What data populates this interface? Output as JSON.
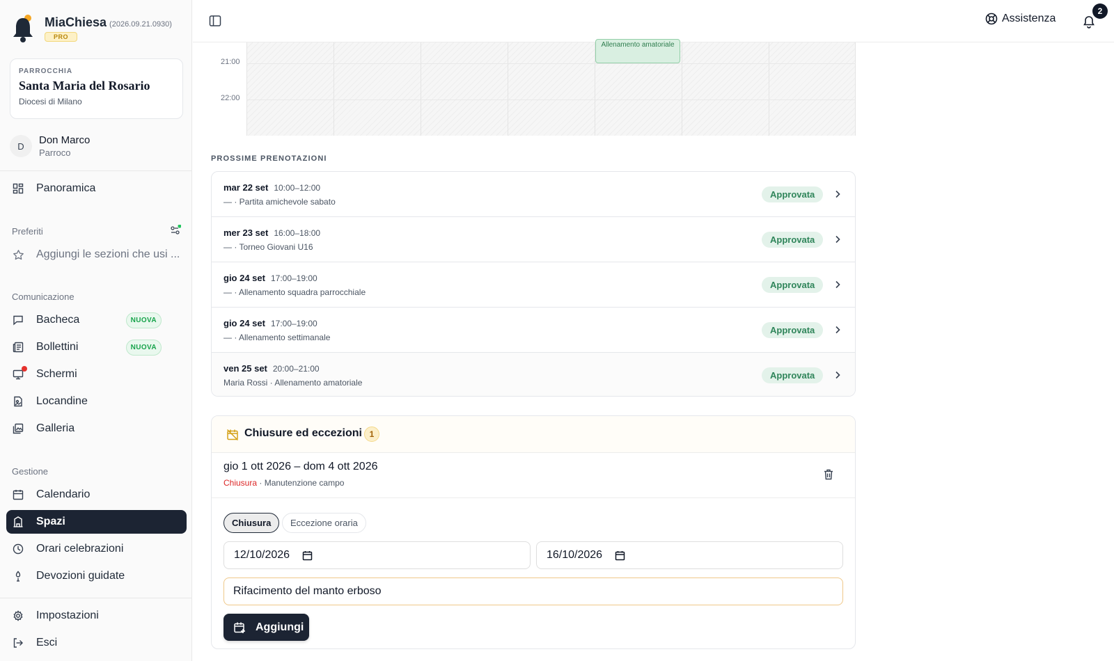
{
  "app": {
    "name": "MiaChiesa",
    "version": "(2026.09.21.0930)",
    "plan": "PRO"
  },
  "parish": {
    "kicker": "PARROCCHIA",
    "name": "Santa Maria del Rosario",
    "diocese": "Diocesi di Milano"
  },
  "user": {
    "initial": "D",
    "name": "Don Marco",
    "role": "Parroco"
  },
  "nav": {
    "overview": "Panoramica",
    "favorites_label": "Preferiti",
    "favorites_hint": "Aggiungi le sezioni che usi ...",
    "communication_label": "Comunicazione",
    "communication": [
      {
        "label": "Bacheca",
        "badge": "NUOVA"
      },
      {
        "label": "Bollettini",
        "badge": "NUOVA"
      },
      {
        "label": "Schermi"
      },
      {
        "label": "Locandine"
      },
      {
        "label": "Galleria"
      }
    ],
    "management_label": "Gestione",
    "management": [
      {
        "label": "Calendario"
      },
      {
        "label": "Spazi"
      },
      {
        "label": "Orari celebrazioni"
      },
      {
        "label": "Devozioni guidate"
      }
    ],
    "settings": "Impostazioni",
    "logout": "Esci"
  },
  "topbar": {
    "help": "Assistenza",
    "notifications": "2"
  },
  "calendar": {
    "times": [
      "21:00",
      "22:00"
    ],
    "event": "Allenamento amatoriale"
  },
  "bookings": {
    "title": "PROSSIME PRENOTAZIONI",
    "items": [
      {
        "date": "mar 22 set",
        "time": "10:00–12:00",
        "desc": "— · Partita amichevole sabato",
        "status": "Approvata"
      },
      {
        "date": "mer 23 set",
        "time": "16:00–18:00",
        "desc": "— · Torneo Giovani U16",
        "status": "Approvata"
      },
      {
        "date": "gio 24 set",
        "time": "17:00–19:00",
        "desc": "— · Allenamento squadra parrocchiale",
        "status": "Approvata"
      },
      {
        "date": "gio 24 set",
        "time": "17:00–19:00",
        "desc": "— · Allenamento settimanale",
        "status": "Approvata"
      },
      {
        "date": "ven 25 set",
        "time": "20:00–21:00",
        "desc": "Maria Rossi · Allenamento amatoriale",
        "status": "Approvata"
      }
    ]
  },
  "closures": {
    "title": "Chiusure ed eccezioni",
    "count": "1",
    "item": {
      "dates": "gio 1 ott 2026 – dom 4 ott 2026",
      "kind": "Chiusura",
      "reason": " · Manutenzione campo"
    },
    "form": {
      "type_closure": "Chiusura",
      "type_exception": "Eccezione oraria",
      "start_date": "12/10/2026",
      "end_date": "16/10/2026",
      "note": "Rifacimento del manto erboso",
      "submit": "Aggiungi"
    }
  }
}
